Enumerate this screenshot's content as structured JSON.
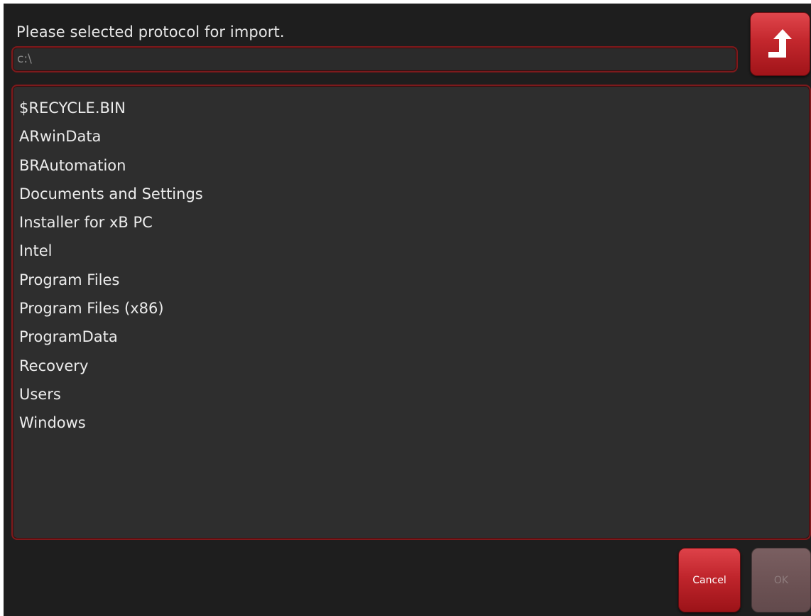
{
  "dialog": {
    "prompt": "Please selected protocol for import.",
    "path_value": "c:\\",
    "up_icon": "folder-up-arrow-icon"
  },
  "files": [
    "$RECYCLE.BIN",
    "ARwinData",
    "BRAutomation",
    "Documents and Settings",
    "Installer for xB PC",
    "Intel",
    "Program Files",
    "Program Files (x86)",
    "ProgramData",
    "Recovery",
    "Users",
    "Windows"
  ],
  "buttons": {
    "cancel_label": "Cancel",
    "ok_label": "OK"
  },
  "colors": {
    "background": "#1e1e1e",
    "panel": "#2e2e2e",
    "accent_red": "#c3272d",
    "border_red": "#7d1a1c",
    "disabled": "#6b5153"
  }
}
